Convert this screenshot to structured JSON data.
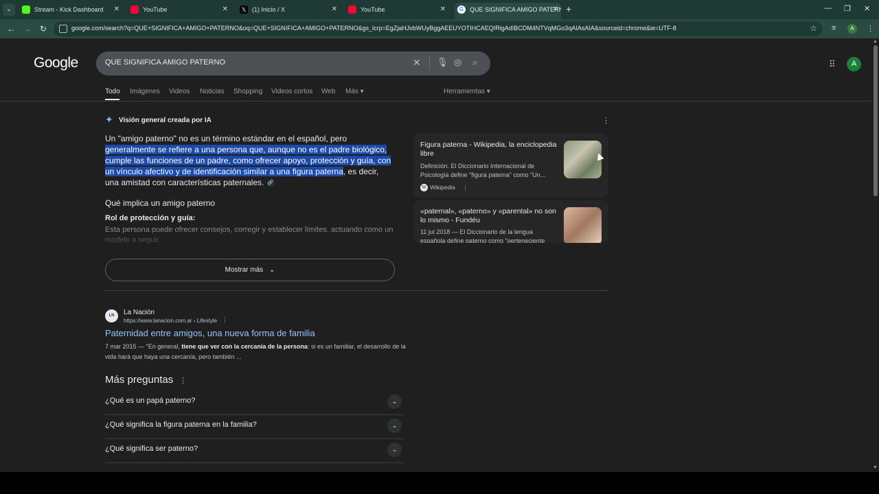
{
  "browser": {
    "tabs": [
      {
        "label": "Stream - Kick Dashboard",
        "color": "#53fc18"
      },
      {
        "label": "YouTube",
        "color": "#ff0033"
      },
      {
        "label": "(1) Inicio / X",
        "color": "#e8eaed"
      },
      {
        "label": "YouTube",
        "color": "#ff0033"
      },
      {
        "label": "QUE SIGNIFICA AMIGO PATERN",
        "color": "#8ab4f8"
      }
    ],
    "url": "google.com/search?q=QUE+SIGNIFICA+AMIGO+PATERNO&oq=QUE+SIGNIFICA+AMIGO+PATERNO&gs_lcrp=EgZjaHJvbWUyBggAEEUYOTIHCAEQIRigAdIBCDM4NTVqMGo3qAIAsAIA&sourceid=chrome&ie=UTF-8",
    "profile_initial": "A"
  },
  "google": {
    "logo": "Google",
    "query": "QUE SIGNIFICA AMIGO PATERNO",
    "avatar_initial": "A",
    "tabs": [
      "Todo",
      "Imágenes",
      "Videos",
      "Noticias",
      "Shopping",
      "Videos cortos",
      "Web",
      "Más ▾"
    ],
    "tools": "Herramientas ▾"
  },
  "ai_overview": {
    "heading": "Visión general creada por IA",
    "para_intro": "Un \"amigo paterno\" no es un término estándar en el español, pero",
    "para_highlight": "generalmente se refiere a una persona que, aunque no es el padre biológico, cumple las funciones de un padre, como ofrecer apoyo, protección y guía, con un vínculo afectivo y de identificación similar a una figura paterna",
    "para_end": ", es decir, una amistad con características paternales.",
    "subheading": "Qué implica un amigo paterno",
    "bold_item": "Rol de protección y guía:",
    "faded_text": "Esta persona puede ofrecer consejos, corregir y establecer límites, actuando como un modelo a seguir.",
    "show_more": "Mostrar más",
    "sources": [
      {
        "title": "Figura paterna - Wikipedia, la enciclopedia libre",
        "desc": "Definición. El Diccionario Internacional de Psicología define \"figura paterna\" como \"Un...",
        "site": "Wikipedia"
      },
      {
        "title": "«paternal», «paterno» y «parental» no son lo mismo - Fundéu",
        "desc": "11 jul 2018 — El Diccionario de la lengua española define paterno como \"perteneciente"
      }
    ]
  },
  "result": {
    "site": "La Nación",
    "url": "https://www.lanacion.com.ar › Lifestyle",
    "title": "Paternidad entre amigos, una nueva forma de familia",
    "date": "7 mar 2015 — \"En general, ",
    "bold": "tiene que ver con la cercanía de la persona",
    "rest": ": si es un familiar, el desarrollo de la vida hará que haya una cercanía, pero también ..."
  },
  "paa": {
    "title": "Más preguntas",
    "questions": [
      "¿Qué es un papá paterno?",
      "¿Qué significa la figura paterna en la familia?",
      "¿Qué significa ser paterno?"
    ]
  }
}
